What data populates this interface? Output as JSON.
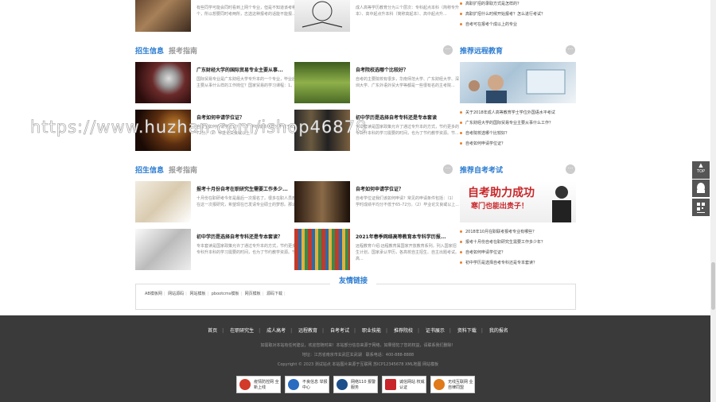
{
  "watermark": "https://www.huzhan.com/ishop46878",
  "top_row": {
    "a1_desc": "有些同学可能会同时看到上网个专业，但是不知道该考哪个，所以想要同时考两所，志选这种报考的话能不能报...",
    "a2_desc": "成人高等学历教育分为三个层次：专科起点本科（简称专升本）、高中起点升本科（简称高起本）、高中起点升...",
    "r1": "高职扩招的录取方式是怎样的？",
    "r2": "高职扩招什么时候开始报考？怎么进行考试？",
    "r3": "自考可在报考个成以上的专业"
  },
  "sec1": {
    "tab_a": "招生信息",
    "tab_b": "报考指南",
    "articles": [
      {
        "title": "广东财经大学的国际贸易专业主要从事...",
        "desc": "国际贸易专业是广东财经大学专升本的一个专业，毕业后就主要从事什么样的工作岗位？国家贸易的学习课程：1、..."
      },
      {
        "title": "自考院校选哪个比较好？",
        "desc": "自考的主要院校有很多，华南师范大学、广东财经大学、深圳大学、广东外语外贸大学等都是一些很有名的主考院..."
      },
      {
        "title": "自考如何申请学位证？",
        "desc": "自考生如何申请学位证？（1）学时成绩平均分不低于65-72分。（2）毕业论文良或以上..."
      },
      {
        "title": "初中学历是选择自考专科还是专本套读",
        "desc": "专本套读是国家政策允许了通过专升本的方式，节约更多的专科升本科的学习需要的时间，也为了节约教学资源。节..."
      }
    ]
  },
  "right1": {
    "title": "推荐远程教育",
    "items": [
      "关于2018年成人高等教育学士学位外国语水平考试",
      "广东财经大学的国际贸易专业主要从事什么工作？",
      "自考院校选哪个比较好？",
      "自考如何申请学位证？"
    ]
  },
  "sec2": {
    "tab_a": "招生信息",
    "tab_b": "报考指南",
    "articles": [
      {
        "title": "报考十月份自考在职研究生需要工作多少...",
        "desc": "十月份在职研考今年是最后一次报名了。很多在职人员想要在这一次报研究，希望现在已发请专业硕士的梦想。那么..."
      },
      {
        "title": "自考如何申请学位证？",
        "desc": "自考学位证我们该如何申请？常见的申请条件包括：（1）学时成绩平均分不低于65-72分。（2）毕业论文良或以上..."
      },
      {
        "title": "初中学历是选择自考专科还是专本套读？",
        "desc": "专本套读是国家政策允许了通过专升本的方式，节约更多的专科升本科的学习需要的时间，也为了节约教学资源。节..."
      },
      {
        "title": "2021年春季网络高等教育本专科学历报...",
        "desc": "远程教育介绍:远程教育属国家开放教育系列。列入国家招生计划，国家承认学历，各高校自主招生、自主出题考试。高..."
      }
    ]
  },
  "right2": {
    "title": "推荐自考考试",
    "banner_line1": "自考助力成功",
    "banner_line2": "寒门也能出贵子！",
    "items": [
      "2018年10月在职联考报考专业有哪些？",
      "报考十月份自考在职研究生需要工作多少年？",
      "自考如何申请学位证？",
      "初中学历是选择自考专科还是专本套读？"
    ]
  },
  "links": {
    "title": "友情链接",
    "items": [
      "AB模板网",
      "网站源码",
      "网站模板",
      "pbootcms模板",
      "网页模板",
      "源码下载"
    ]
  },
  "footer": {
    "nav": [
      "首页",
      "在职研究生",
      "成人高考",
      "远程教育",
      "自考考试",
      "职业技能",
      "推荐院校",
      "证书展示",
      "资料下载",
      "我的报名"
    ],
    "line1": "如需取对本站有任何建议，欢迎您随时来！本站部分信息来源于网络，如果侵犯了您的权益，请联系我们删除！",
    "line2": "地址：江苏省南京市玄武区玄武湖　联系电话：400-888-8888",
    "line3": "Copyright © 2023 测试站点 本站图片来源于互联网 苏ICP12345678 XML地图 网站模板",
    "badges": [
      "疫情防控网 全新上线",
      "不良信息 举报中心",
      "网络110 报警服务",
      "诚信网站 权威认证",
      "无线互联网 业自律同盟"
    ]
  },
  "side": {
    "top": "TOP"
  }
}
